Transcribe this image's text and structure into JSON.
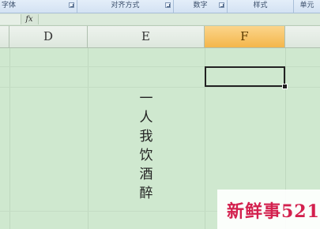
{
  "ribbon": {
    "groups": [
      {
        "label": "字体"
      },
      {
        "label": "对齐方式"
      },
      {
        "label": "数字"
      },
      {
        "label": "样式"
      },
      {
        "label": "单元"
      }
    ]
  },
  "formula_bar": {
    "fx_label": "fx",
    "value": ""
  },
  "columns": [
    {
      "label": "D",
      "selected": false
    },
    {
      "label": "E",
      "selected": false
    },
    {
      "label": "F",
      "selected": true
    }
  ],
  "sheet": {
    "cell_E_text": [
      "一",
      "人",
      "我",
      "饮",
      "酒",
      "醉"
    ],
    "active_cell_value": ""
  },
  "watermark": {
    "text": "新鲜事521",
    "color": "#d3204e"
  },
  "colors": {
    "grid_bg": "#cfe8cf",
    "selected_header": "#f4b64b"
  }
}
